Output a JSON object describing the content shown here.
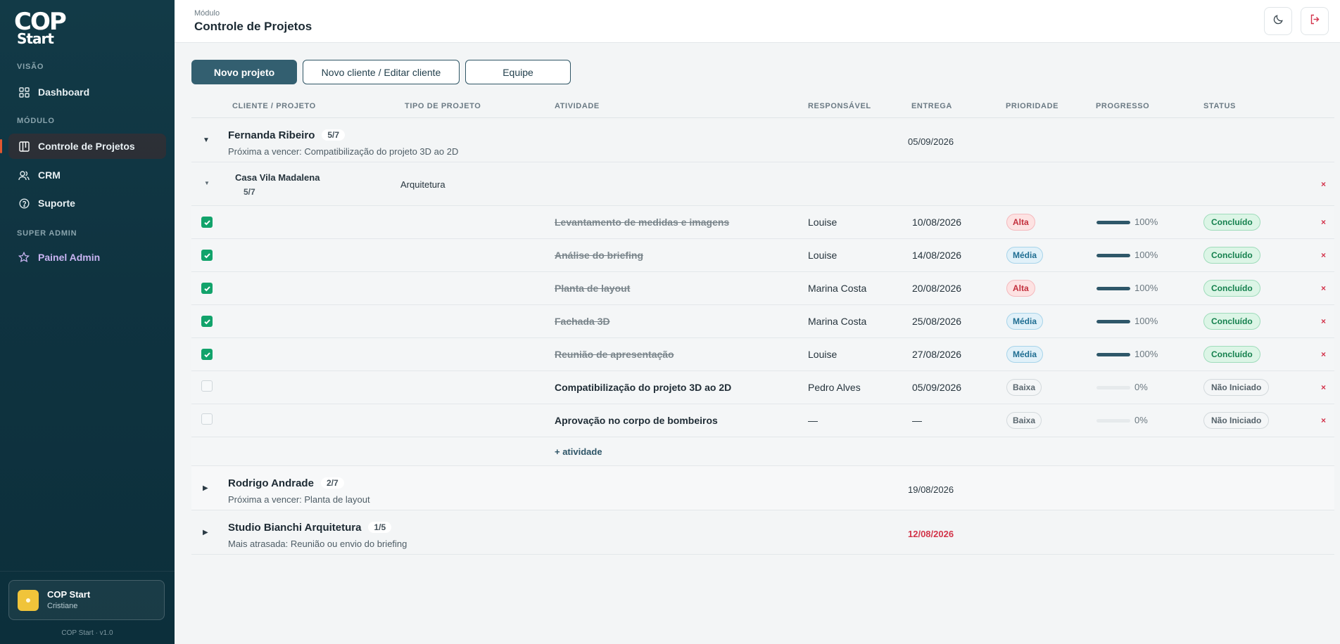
{
  "sidebar": {
    "logo_line1": "COP",
    "logo_line2": "Start",
    "sections": {
      "visao": "VISÃO",
      "modulo": "MÓDULO",
      "super_admin": "SUPER ADMIN"
    },
    "items": {
      "dashboard": "Dashboard",
      "controle": "Controle de Projetos",
      "crm": "CRM",
      "suporte": "Suporte",
      "painel_admin": "Painel Admin"
    },
    "user": {
      "name": "COP Start",
      "sub": "Cristiane"
    },
    "version": "COP Start · v1.0"
  },
  "header": {
    "crumb": "Módulo",
    "title": "Controle de Projetos"
  },
  "toolbar": {
    "new_project": "Novo projeto",
    "client": "Novo cliente / Editar cliente",
    "team": "Equipe"
  },
  "columns": {
    "client": "CLIENTE / PROJETO",
    "type": "TIPO DE PROJETO",
    "activity": "ATIVIDADE",
    "resp": "RESPONSÁVEL",
    "delivery": "ENTREGA",
    "priority": "PRIORIDADE",
    "progress": "PROGRESSO",
    "status": "STATUS"
  },
  "groups": [
    {
      "name": "Fernanda Ribeiro",
      "count": "5/7",
      "sub": "Próxima a vencer: Compatibilização do projeto 3D ao 2D",
      "date": "05/09/2026",
      "project": {
        "name": "Casa Vila Madalena",
        "count": "5/7",
        "type": "Arquitetura"
      },
      "activities": [
        {
          "name": "Levantamento de medidas e imagens",
          "resp": "Louise",
          "date": "10/08/2026",
          "priority": "Alta",
          "progress": 1,
          "progress_label": "100%",
          "status": "Concluído"
        },
        {
          "name": "Análise do briefing",
          "resp": "Louise",
          "date": "14/08/2026",
          "priority": "Média",
          "progress": 1,
          "progress_label": "100%",
          "status": "Concluído"
        },
        {
          "name": "Planta de layout",
          "resp": "Marina Costa",
          "date": "20/08/2026",
          "priority": "Alta",
          "progress": 1,
          "progress_label": "100%",
          "status": "Concluído"
        },
        {
          "name": "Fachada 3D",
          "resp": "Marina Costa",
          "date": "25/08/2026",
          "priority": "Média",
          "progress": 1,
          "progress_label": "100%",
          "status": "Concluído"
        },
        {
          "name": "Reunião de apresentação",
          "resp": "Louise",
          "date": "27/08/2026",
          "priority": "Média",
          "progress": 1,
          "progress_label": "100%",
          "status": "Concluído"
        },
        {
          "name": "Compatibilização do projeto 3D ao 2D",
          "resp": "Pedro Alves",
          "date": "05/09/2026",
          "priority": "Baixa",
          "progress": 0,
          "progress_label": "0%",
          "status": "Não Iniciado"
        },
        {
          "name": "Aprovação no corpo de bombeiros",
          "resp": "—",
          "date": "—",
          "priority": "Baixa",
          "progress": 0,
          "progress_label": "0%",
          "status": "Não Iniciado"
        }
      ],
      "add_activity": "+ atividade"
    },
    {
      "name": "Rodrigo Andrade",
      "count": "2/7",
      "sub": "Próxima a vencer: Planta de layout",
      "date": "19/08/2026"
    },
    {
      "name": "Studio Bianchi Arquitetura",
      "count": "1/5",
      "sub": "Mais atrasada: Reunião ou envio do briefing",
      "date": "12/08/2026"
    }
  ],
  "delete_glyph": "×",
  "colors": {
    "accent": "#335f70",
    "sidebar": "#0f3340",
    "success": "#14804d",
    "danger": "#d3344c"
  }
}
